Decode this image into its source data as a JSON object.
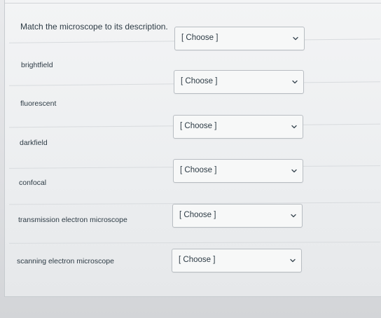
{
  "question": {
    "prompt": "Match the microscope to its description."
  },
  "rows": [
    {
      "label": "brightfield",
      "select_value": "[ Choose ]"
    },
    {
      "label": "fluorescent",
      "select_value": "[ Choose ]"
    },
    {
      "label": "darkfield",
      "select_value": "[ Choose ]"
    },
    {
      "label": "confocal",
      "select_value": "[ Choose ]"
    },
    {
      "label": "transmission electron microscope",
      "select_value": "[ Choose ]"
    },
    {
      "label": "scanning electron microscope",
      "select_value": "[ Choose ]"
    }
  ],
  "colors": {
    "text": "#2d3b45",
    "select_border": "#b8bdc2",
    "select_background": "#f7f8f8"
  },
  "icons": {
    "dropdown": "chevron-down-icon"
  }
}
